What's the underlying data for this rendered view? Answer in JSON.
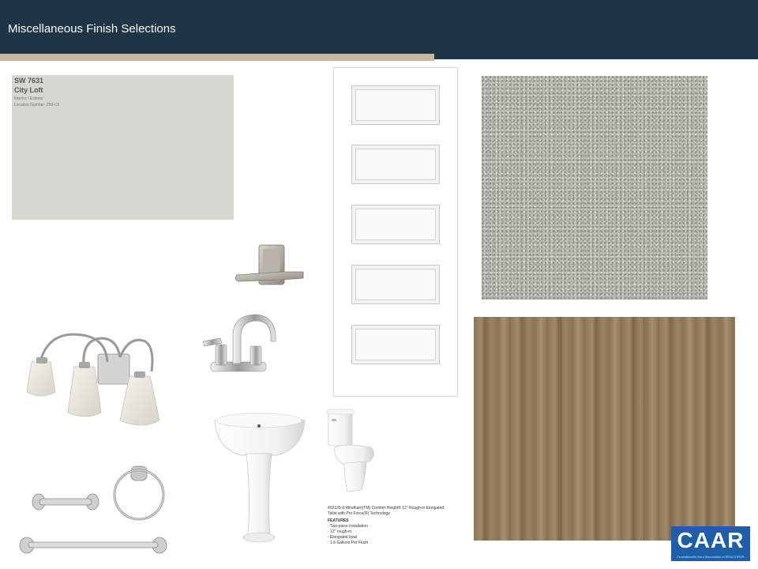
{
  "header": {
    "title": "Miscellaneous Finish Selections"
  },
  "paint_chip": {
    "code": "SW 7631",
    "name": "City Loft",
    "line1": "Interior / Exterior",
    "line2": "Location Number: 259-C6"
  },
  "toilet": {
    "description": "402125-0 Windham(TM) Comfort Height® 12\" Rough-in Elongated Toilet with Pro Force(R) Technology",
    "features_title": "FEATURES",
    "features": [
      "Two-piece installation",
      "12\" rough-in",
      "Elongated bowl",
      "1.6 Gallons Per Flush"
    ]
  },
  "logo": {
    "text": "CAAR",
    "tagline": "Charlottesville Area Association of REALTORS®"
  },
  "colors": {
    "header": "#1e3447",
    "accent": "#c7b9a2",
    "paint": "#d9d6d2",
    "logo": "#1d5fa8"
  },
  "icons": [
    "lever-handle-icon",
    "faucet-icon",
    "vanity-light-icon",
    "pedestal-sink-icon",
    "toilet-icon",
    "towel-ring-icon",
    "towel-bar-icon",
    "tp-holder-icon"
  ]
}
